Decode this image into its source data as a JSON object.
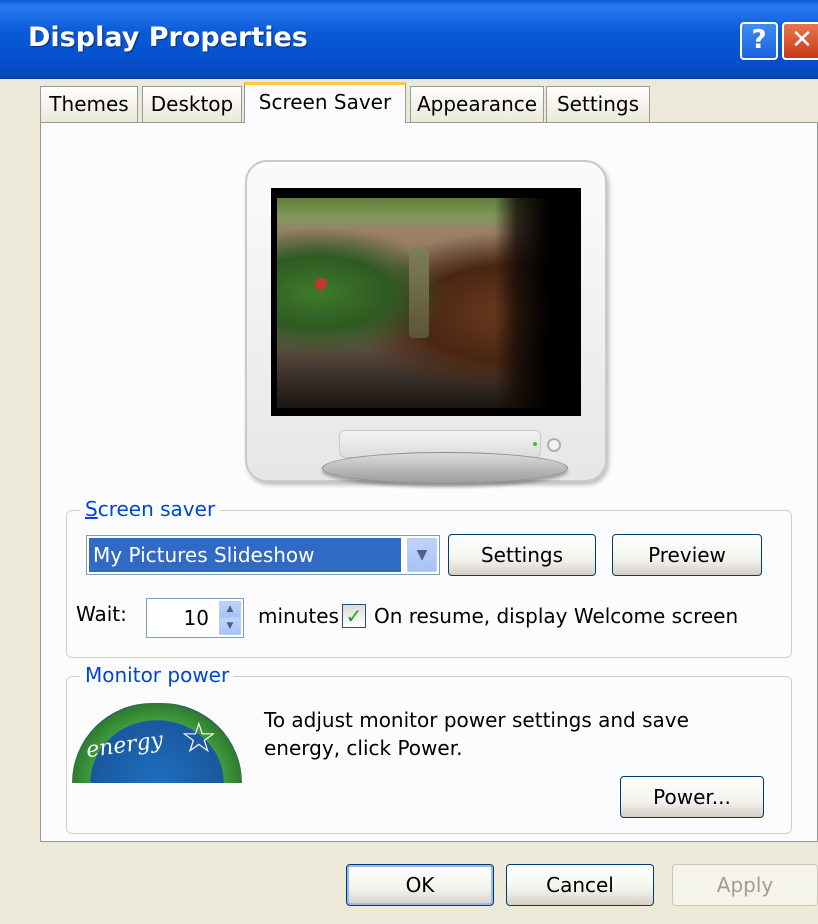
{
  "window": {
    "title": "Display Properties",
    "help_label": "?",
    "close_label": "✕"
  },
  "tabs": [
    {
      "label": "Themes"
    },
    {
      "label": "Desktop"
    },
    {
      "label": "Screen Saver",
      "active": true
    },
    {
      "label": "Appearance"
    },
    {
      "label": "Settings"
    }
  ],
  "screen_saver": {
    "group_label": "Screen saver",
    "selected": "My Pictures Slideshow",
    "settings_button": "Settings",
    "preview_button": "Preview",
    "wait_label": "Wait:",
    "wait_value": "10",
    "minutes_label": "minutes",
    "resume_checked": true,
    "resume_label": "On resume, display Welcome screen"
  },
  "monitor_power": {
    "group_label": "Monitor power",
    "description": "To adjust monitor power settings and save energy, click Power.",
    "power_button": "Power...",
    "logo_text": "energy"
  },
  "dialog_buttons": {
    "ok": "OK",
    "cancel": "Cancel",
    "apply": "Apply"
  },
  "colors": {
    "titlebar": "#0653d1",
    "selection": "#316ac5",
    "group_label": "#0046d5",
    "tab_highlight": "#ffc83c"
  }
}
